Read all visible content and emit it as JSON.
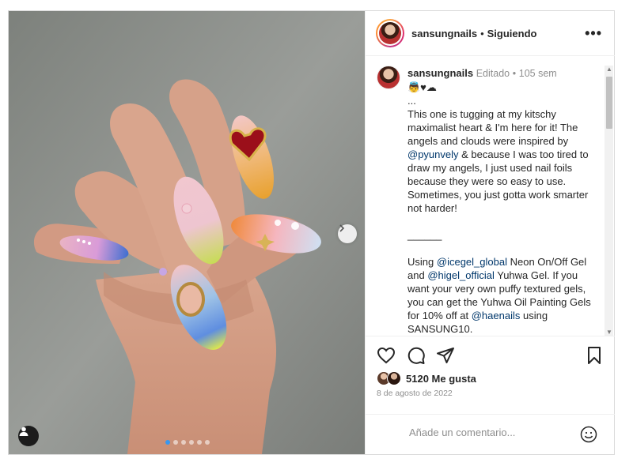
{
  "post": {
    "username": "sansungnails",
    "separator": "•",
    "follow_label": "Siguiendo",
    "more_label": "•••"
  },
  "caption": {
    "username": "sansungnails",
    "edited": "Editado",
    "dot": "•",
    "age": "105 sem",
    "emojis": "👼♥☁",
    "ellipsis": "...",
    "p1": "This one is tugging at my kitschy maximalist heart & I'm here for it! The angels and clouds were inspired by",
    "mention1": "@pyunvely",
    "p2": "& because I was too tired to draw my angels, I just used nail foils because they were so easy to use. Sometimes, you just gotta work smarter not harder!",
    "divider": "______",
    "p3a": "Using",
    "mention2": "@icegel_global",
    "p3b": "Neon On/Off Gel and",
    "mention3": "@higel_official",
    "p3c": "Yuhwa Gel. If you want your very own puffy textured gels, you can get the Yuhwa Oil Painting Gels for 10% off at",
    "mention4": "@haenails",
    "p3d": "using SANSUNG10."
  },
  "likes": {
    "text": "5120 Me gusta"
  },
  "date": "8 de agosto de 2022",
  "comment": {
    "placeholder": "Añade un comentario..."
  },
  "carousel": {
    "slides": 6,
    "active": 1
  },
  "icons": {
    "like": "heart-icon",
    "comment": "comment-icon",
    "share": "share-icon",
    "save": "bookmark-icon",
    "emoji": "emoji-icon",
    "tag": "user-tag-icon",
    "next": "chevron-right-icon",
    "more": "more-icon"
  },
  "colors": {
    "text": "#262626",
    "muted": "#8e8e8e",
    "mention": "#00376b",
    "border": "#efefef",
    "carousel_active": "#3897f0"
  }
}
